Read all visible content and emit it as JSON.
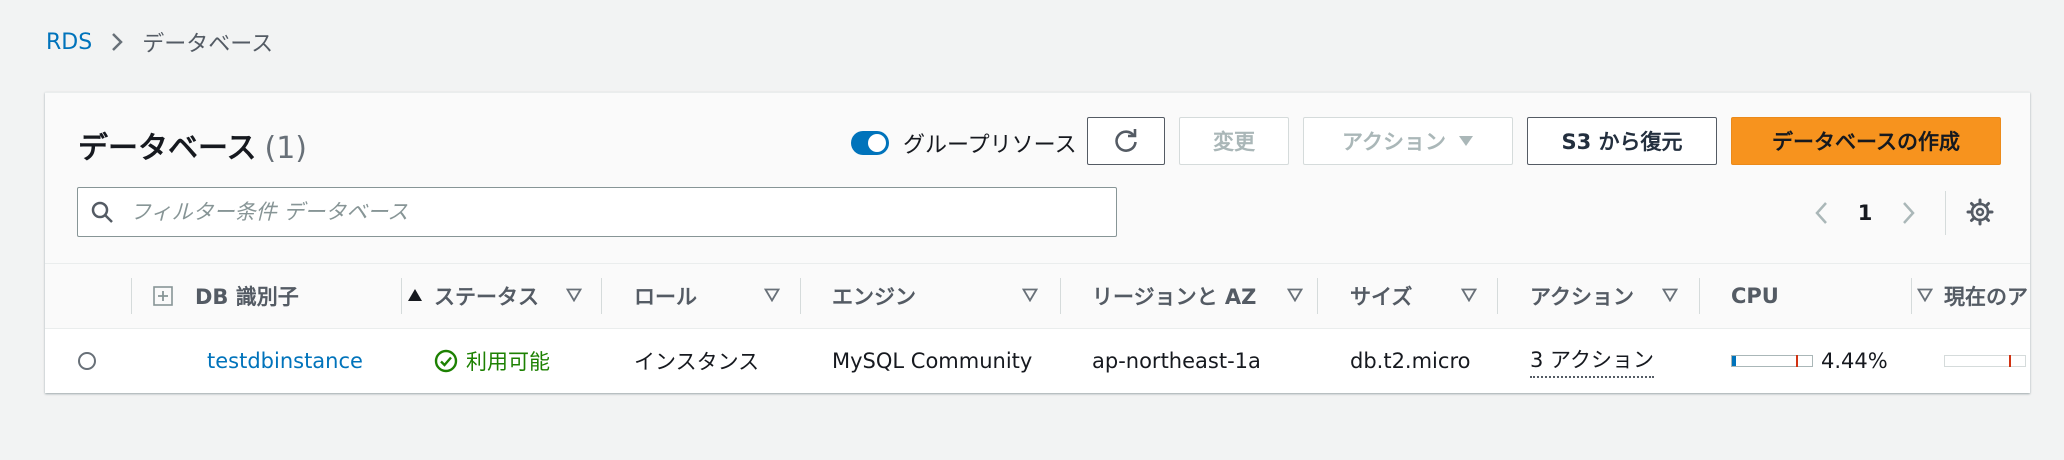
{
  "breadcrumb": {
    "root": "RDS",
    "current": "データベース"
  },
  "header": {
    "title": "データベース",
    "count": "(1)",
    "group_toggle_label": "グループリソース",
    "group_toggle_on": true,
    "buttons": {
      "modify": "変更",
      "actions": "アクション",
      "restore_s3": "S3 から復元",
      "create": "データベースの作成"
    }
  },
  "search": {
    "placeholder": "フィルター条件 データベース",
    "value": ""
  },
  "pagination": {
    "current_page": "1"
  },
  "table": {
    "columns": {
      "db_id": "DB 識別子",
      "status": "ステータス",
      "role": "ロール",
      "engine": "エンジン",
      "region_az": "リージョンと AZ",
      "size": "サイズ",
      "actions": "アクション",
      "cpu": "CPU",
      "current": "現在のア"
    },
    "rows": [
      {
        "db_id": "testdbinstance",
        "status": "利用可能",
        "role": "インスタンス",
        "engine": "MySQL Community",
        "region_az": "ap-northeast-1a",
        "size": "db.t2.micro",
        "actions": "3 アクション",
        "cpu_text": "4.44%",
        "cpu_percent": 4.44
      }
    ]
  },
  "colors": {
    "link": "#0073bb",
    "primary_button": "#f7931e",
    "status_available": "#1d8102",
    "meter_threshold": "#d13212"
  }
}
